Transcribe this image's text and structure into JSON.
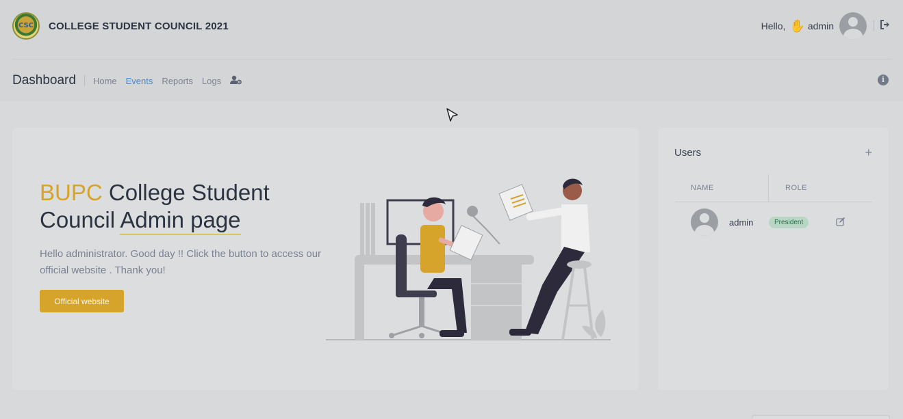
{
  "header": {
    "brand_title": "COLLEGE STUDENT COUNCIL 2021",
    "logo_text": "CSC",
    "greeting": "Hello,",
    "wave_icon": "✋",
    "username": "admin",
    "logout_icon": "logout-icon"
  },
  "nav": {
    "page_title": "Dashboard",
    "links": [
      "Home",
      "Events",
      "Reports",
      "Logs"
    ],
    "active": "Events"
  },
  "hero": {
    "title_accent": "BUPC",
    "title_rest_line1": " College Student",
    "title_line2_plain": "Council ",
    "title_line2_underlined": "Admin page",
    "text": "Hello administrator. Good day !! Click the button to access our official website . Thank you!",
    "button_label": "Official website"
  },
  "users_card": {
    "title": "Users",
    "add_label": "+",
    "columns": [
      "NAME",
      "ROLE"
    ],
    "rows": [
      {
        "name": "admin",
        "role": "President"
      }
    ]
  },
  "colors": {
    "accent": "#d7a42b",
    "link_active": "#4f87c7",
    "badge_bg": "#b7d7c4"
  }
}
